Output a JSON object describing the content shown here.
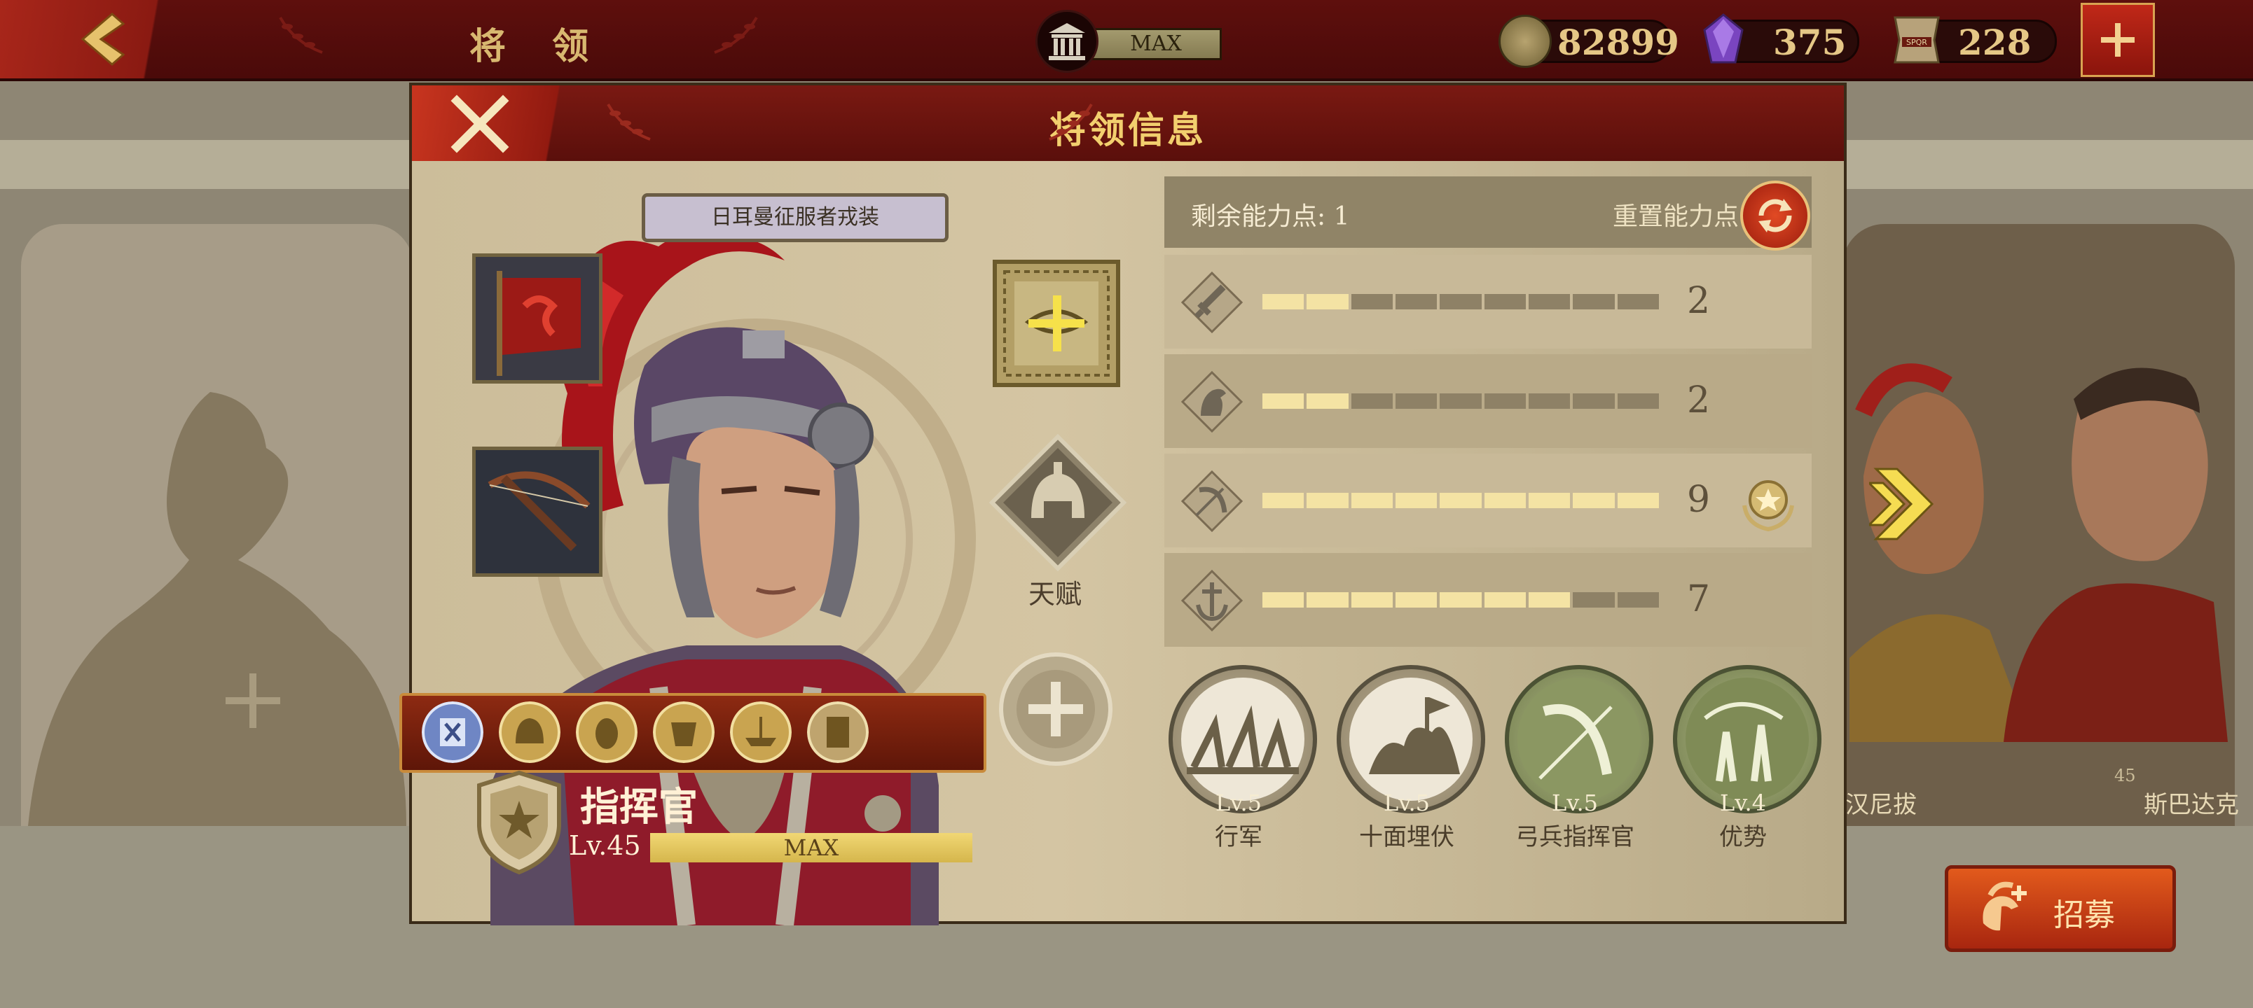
{
  "topbar": {
    "title": "将 领",
    "building_level": "MAX",
    "gold": "82899",
    "gems": "375",
    "tokens": "228"
  },
  "background": {
    "recruit_label": "招募",
    "hero_right_1_name": "汉尼拔",
    "hero_right_2_name": "斯巴达克",
    "hero_right_2_level": "45"
  },
  "dialog": {
    "title": "将领信息",
    "outfit_label": "日耳曼征服者戎装",
    "talent_label": "天赋",
    "rank_title": "指挥官",
    "level_text": "Lv.45",
    "level_bar_label": "MAX"
  },
  "stats": {
    "points_label": "剩余能力点: 1",
    "reset_label": "重置能力点",
    "rows": [
      {
        "icon": "sword-icon",
        "value": 2
      },
      {
        "icon": "horse-icon",
        "value": 2
      },
      {
        "icon": "bow-icon",
        "value": 9
      },
      {
        "icon": "anchor-icon",
        "value": 7
      }
    ],
    "max_points": 9
  },
  "abilities": [
    {
      "level": "Lv.5",
      "name": "行军"
    },
    {
      "level": "Lv.5",
      "name": "十面埋伏"
    },
    {
      "level": "Lv.5",
      "name": "弓兵指挥官"
    },
    {
      "level": "Lv.4",
      "name": "优势"
    }
  ],
  "colors": {
    "accent_red": "#7a1912",
    "gold_text": "#f2cf6e",
    "bar_filled": "#f4e3a4",
    "bar_empty": "#8e8166"
  }
}
